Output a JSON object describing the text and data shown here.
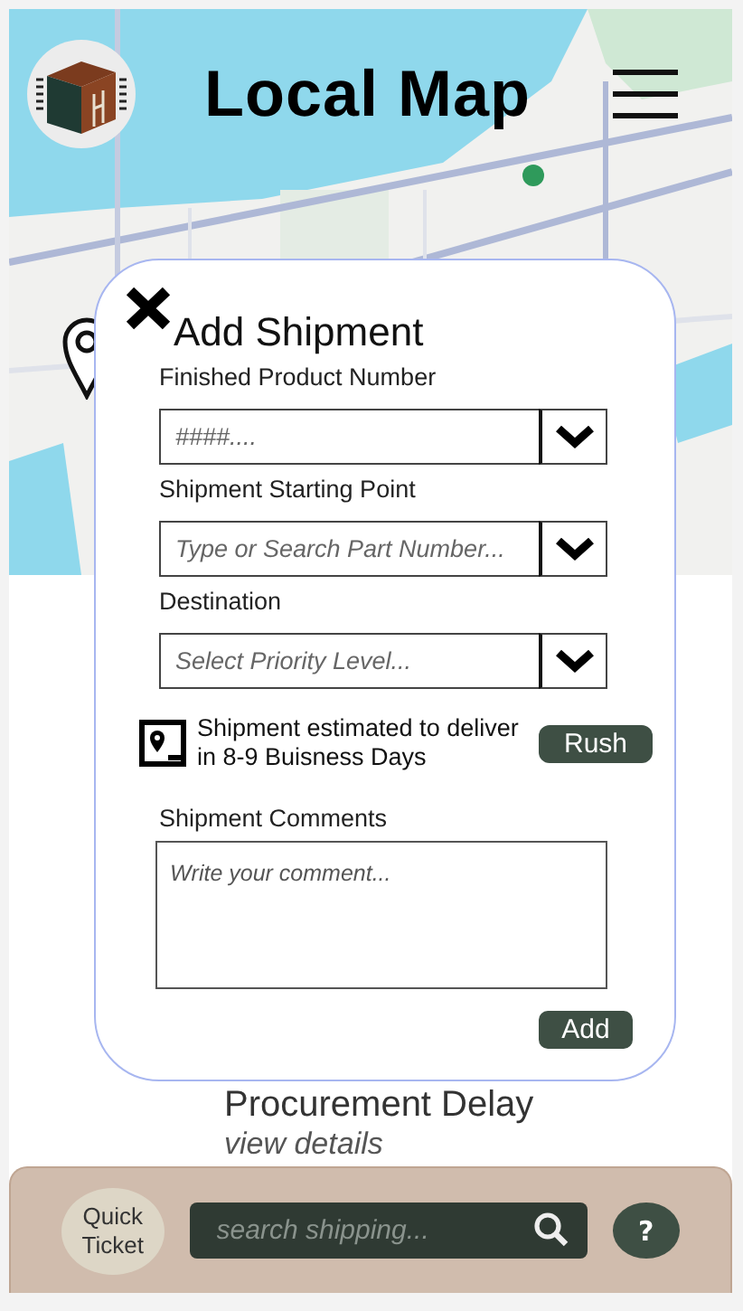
{
  "header": {
    "title": "Local Map"
  },
  "background_item": {
    "title": "Procurement Delay",
    "link": "view details"
  },
  "modal": {
    "title": "Add Shipment",
    "fields": [
      {
        "label": "Finished Product Number",
        "placeholder": "####...."
      },
      {
        "label": "Shipment Starting Point",
        "placeholder": "Type or Search Part Number..."
      },
      {
        "label": "Destination",
        "placeholder": "Select Priority Level..."
      }
    ],
    "estimate": "Shipment estimated to deliver in 8-9 Buisness Days",
    "rush_button": "Rush",
    "comments": {
      "label": "Shipment Comments",
      "placeholder": "Write your comment..."
    },
    "add_button": "Add"
  },
  "bottom_bar": {
    "quick_ticket": "Quick Ticket",
    "search": {
      "placeholder": "search shipping..."
    },
    "help": "?"
  }
}
